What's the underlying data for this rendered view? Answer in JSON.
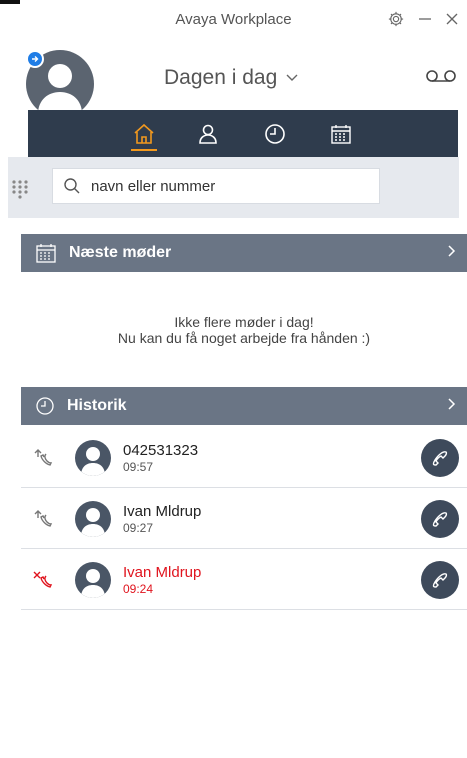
{
  "window": {
    "title": "Avaya Workplace"
  },
  "header": {
    "day_label": "Dagen i dag"
  },
  "search": {
    "placeholder": "navn eller nummer",
    "value": ""
  },
  "meetings": {
    "title": "Næste møder",
    "empty_line1": "Ikke flere møder i dag!",
    "empty_line2": "Nu kan du få noget arbejde fra hånden :)"
  },
  "history": {
    "title": "Historik",
    "items": [
      {
        "name": "042531323",
        "time": "09:57",
        "type": "outgoing"
      },
      {
        "name": "Ivan  Mldrup",
        "time": "09:27",
        "type": "outgoing"
      },
      {
        "name": "Ivan  Mldrup",
        "time": "09:24",
        "type": "missed"
      }
    ]
  },
  "colors": {
    "nav_bg": "#2f3c4d",
    "accent": "#f2991e",
    "section_bg": "#6a7585",
    "missed": "#e0141e",
    "presence": "#1f7de6"
  },
  "icons": {
    "nav": [
      "home-icon",
      "contacts-icon",
      "history-icon",
      "calendar-icon"
    ],
    "header": [
      "settings-icon",
      "minimize-icon",
      "close-icon",
      "voicemail-icon",
      "dialpad-icon",
      "search-icon"
    ]
  }
}
